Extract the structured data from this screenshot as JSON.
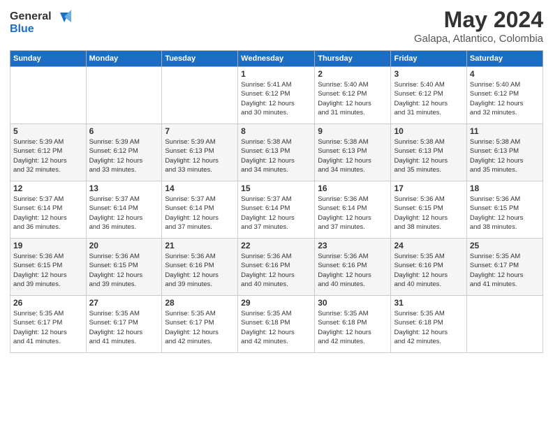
{
  "logo": {
    "line1": "General",
    "line2": "Blue"
  },
  "title": "May 2024",
  "subtitle": "Galapa, Atlantico, Colombia",
  "weekdays": [
    "Sunday",
    "Monday",
    "Tuesday",
    "Wednesday",
    "Thursday",
    "Friday",
    "Saturday"
  ],
  "weeks": [
    [
      {
        "day": "",
        "info": ""
      },
      {
        "day": "",
        "info": ""
      },
      {
        "day": "",
        "info": ""
      },
      {
        "day": "1",
        "info": "Sunrise: 5:41 AM\nSunset: 6:12 PM\nDaylight: 12 hours\nand 30 minutes."
      },
      {
        "day": "2",
        "info": "Sunrise: 5:40 AM\nSunset: 6:12 PM\nDaylight: 12 hours\nand 31 minutes."
      },
      {
        "day": "3",
        "info": "Sunrise: 5:40 AM\nSunset: 6:12 PM\nDaylight: 12 hours\nand 31 minutes."
      },
      {
        "day": "4",
        "info": "Sunrise: 5:40 AM\nSunset: 6:12 PM\nDaylight: 12 hours\nand 32 minutes."
      }
    ],
    [
      {
        "day": "5",
        "info": "Sunrise: 5:39 AM\nSunset: 6:12 PM\nDaylight: 12 hours\nand 32 minutes."
      },
      {
        "day": "6",
        "info": "Sunrise: 5:39 AM\nSunset: 6:12 PM\nDaylight: 12 hours\nand 33 minutes."
      },
      {
        "day": "7",
        "info": "Sunrise: 5:39 AM\nSunset: 6:13 PM\nDaylight: 12 hours\nand 33 minutes."
      },
      {
        "day": "8",
        "info": "Sunrise: 5:38 AM\nSunset: 6:13 PM\nDaylight: 12 hours\nand 34 minutes."
      },
      {
        "day": "9",
        "info": "Sunrise: 5:38 AM\nSunset: 6:13 PM\nDaylight: 12 hours\nand 34 minutes."
      },
      {
        "day": "10",
        "info": "Sunrise: 5:38 AM\nSunset: 6:13 PM\nDaylight: 12 hours\nand 35 minutes."
      },
      {
        "day": "11",
        "info": "Sunrise: 5:38 AM\nSunset: 6:13 PM\nDaylight: 12 hours\nand 35 minutes."
      }
    ],
    [
      {
        "day": "12",
        "info": "Sunrise: 5:37 AM\nSunset: 6:14 PM\nDaylight: 12 hours\nand 36 minutes."
      },
      {
        "day": "13",
        "info": "Sunrise: 5:37 AM\nSunset: 6:14 PM\nDaylight: 12 hours\nand 36 minutes."
      },
      {
        "day": "14",
        "info": "Sunrise: 5:37 AM\nSunset: 6:14 PM\nDaylight: 12 hours\nand 37 minutes."
      },
      {
        "day": "15",
        "info": "Sunrise: 5:37 AM\nSunset: 6:14 PM\nDaylight: 12 hours\nand 37 minutes."
      },
      {
        "day": "16",
        "info": "Sunrise: 5:36 AM\nSunset: 6:14 PM\nDaylight: 12 hours\nand 37 minutes."
      },
      {
        "day": "17",
        "info": "Sunrise: 5:36 AM\nSunset: 6:15 PM\nDaylight: 12 hours\nand 38 minutes."
      },
      {
        "day": "18",
        "info": "Sunrise: 5:36 AM\nSunset: 6:15 PM\nDaylight: 12 hours\nand 38 minutes."
      }
    ],
    [
      {
        "day": "19",
        "info": "Sunrise: 5:36 AM\nSunset: 6:15 PM\nDaylight: 12 hours\nand 39 minutes."
      },
      {
        "day": "20",
        "info": "Sunrise: 5:36 AM\nSunset: 6:15 PM\nDaylight: 12 hours\nand 39 minutes."
      },
      {
        "day": "21",
        "info": "Sunrise: 5:36 AM\nSunset: 6:16 PM\nDaylight: 12 hours\nand 39 minutes."
      },
      {
        "day": "22",
        "info": "Sunrise: 5:36 AM\nSunset: 6:16 PM\nDaylight: 12 hours\nand 40 minutes."
      },
      {
        "day": "23",
        "info": "Sunrise: 5:36 AM\nSunset: 6:16 PM\nDaylight: 12 hours\nand 40 minutes."
      },
      {
        "day": "24",
        "info": "Sunrise: 5:35 AM\nSunset: 6:16 PM\nDaylight: 12 hours\nand 40 minutes."
      },
      {
        "day": "25",
        "info": "Sunrise: 5:35 AM\nSunset: 6:17 PM\nDaylight: 12 hours\nand 41 minutes."
      }
    ],
    [
      {
        "day": "26",
        "info": "Sunrise: 5:35 AM\nSunset: 6:17 PM\nDaylight: 12 hours\nand 41 minutes."
      },
      {
        "day": "27",
        "info": "Sunrise: 5:35 AM\nSunset: 6:17 PM\nDaylight: 12 hours\nand 41 minutes."
      },
      {
        "day": "28",
        "info": "Sunrise: 5:35 AM\nSunset: 6:17 PM\nDaylight: 12 hours\nand 42 minutes."
      },
      {
        "day": "29",
        "info": "Sunrise: 5:35 AM\nSunset: 6:18 PM\nDaylight: 12 hours\nand 42 minutes."
      },
      {
        "day": "30",
        "info": "Sunrise: 5:35 AM\nSunset: 6:18 PM\nDaylight: 12 hours\nand 42 minutes."
      },
      {
        "day": "31",
        "info": "Sunrise: 5:35 AM\nSunset: 6:18 PM\nDaylight: 12 hours\nand 42 minutes."
      },
      {
        "day": "",
        "info": ""
      }
    ]
  ]
}
